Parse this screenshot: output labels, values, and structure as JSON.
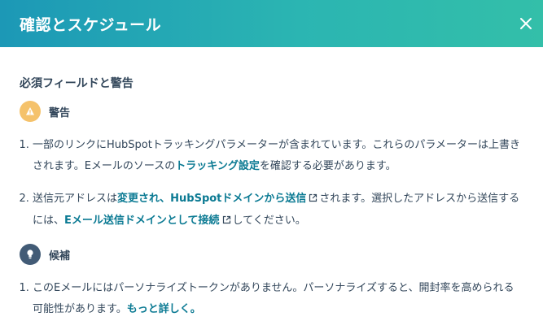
{
  "header": {
    "title": "確認とスケジュール"
  },
  "section": {
    "title": "必須フィールドと警告"
  },
  "warning": {
    "label": "警告",
    "items": [
      {
        "num": "1.",
        "text_before": "一部のリンクにHubSpotトラッキングパラメーターが含まれています。これらのパラメーターは上書きされます。Eメールのソースの",
        "link": "トラッキング設定",
        "text_after": "を確認する必要があります。"
      },
      {
        "num": "2.",
        "text_before": "送信元アドレスは",
        "link1": "変更され、HubSpotドメインから送信",
        "text_middle": "されます。選択したアドレスから送信するには、",
        "link2": "Eメール送信ドメインとして接続",
        "text_after": "してください。"
      }
    ]
  },
  "suggestion": {
    "label": "候補",
    "items": [
      {
        "num": "1.",
        "text_before": "このEメールにはパーソナライズトークンがありません。パーソナライズすると、開封率を高められる可能性があります。",
        "link": "もっと詳しく。"
      }
    ]
  },
  "colors": {
    "header_start": "#1c98b6",
    "header_end": "#33bfa9",
    "link": "#0b7a93",
    "warning_icon_bg": "#f5c26b",
    "suggestion_icon_bg": "#425b76",
    "text": "#33475b"
  },
  "icons": {
    "close": "close-icon",
    "warning": "warning-icon",
    "suggestion": "lightbulb-icon",
    "external": "external-link-icon"
  }
}
